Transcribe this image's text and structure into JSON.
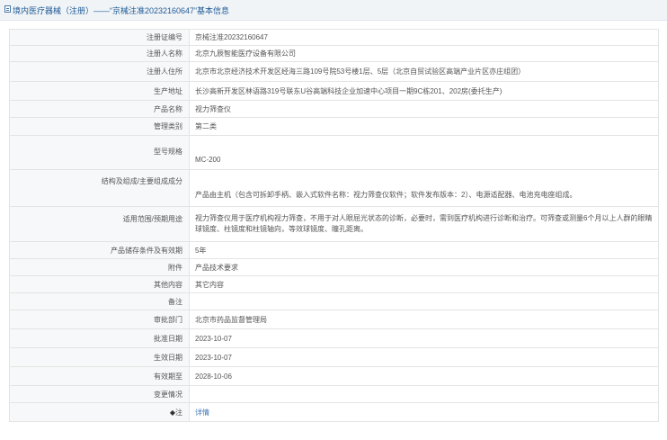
{
  "page": {
    "title": "境内医疗器械（注册）——“京械注准20232160647”基本信息"
  },
  "rows": [
    {
      "label": "注册证编号",
      "value": "京械注准20232160647"
    },
    {
      "label": "注册人名称",
      "value": "北京九辰智能医疗设备有限公司"
    },
    {
      "label": "注册人住所",
      "value": "北京市北京经济技术开发区经海三路109号院53号楼1层、5层（北京自贸试验区高端产业片区亦庄组团）"
    },
    {
      "label": "生产地址",
      "value": "长沙高新开发区林语路319号联东U谷高端科技企业加速中心项目一期9C栋201、202房(委托生产)"
    },
    {
      "label": "产品名称",
      "value": "视力筛查仪"
    },
    {
      "label": "管理类别",
      "value": "第二类"
    },
    {
      "label": "型号规格",
      "value": "MC-200"
    },
    {
      "label": "结构及组成/主要组成成分",
      "value": "产品由主机（包含可拆卸手柄、嵌入式软件名称：视力筛查仪软件；软件发布版本：2）、电源适配器、电池充电座组成。"
    },
    {
      "label": "适用范围/预期用途",
      "value": "视力筛查仪用于医疗机构视力筛查，不用于对人眼屈光状态的诊断，必要时，需到医疗机构进行诊断和治疗。可筛查或测量6个月以上人群的眼睛球镜度、柱镜度和柱镜轴向，等效球镜度、瞳孔距离。"
    },
    {
      "label": "产品储存条件及有效期",
      "value": "5年"
    },
    {
      "label": "附件",
      "value": "产品技术要求"
    },
    {
      "label": "其他内容",
      "value": "其它内容"
    },
    {
      "label": "备注",
      "value": ""
    },
    {
      "label": "审批部门",
      "value": "北京市药品监督管理局"
    },
    {
      "label": "批准日期",
      "value": "2023-10-07"
    },
    {
      "label": "生效日期",
      "value": "2023-10-07"
    },
    {
      "label": "有效期至",
      "value": "2028-10-06"
    },
    {
      "label": "变更情况",
      "value": ""
    }
  ],
  "note_row": {
    "bullet": "◆",
    "label": "注",
    "link": "详情"
  }
}
